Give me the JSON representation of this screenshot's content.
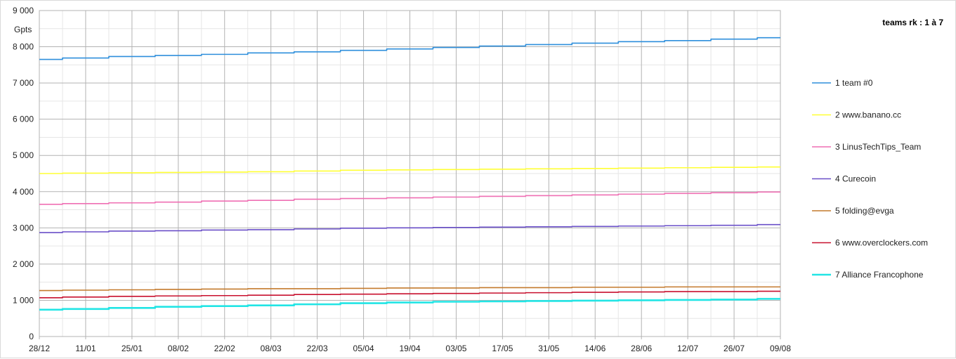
{
  "chart_data": {
    "type": "line",
    "ylabel": "Gpts",
    "ylim": [
      0,
      9000
    ],
    "ytick_labels": [
      "0",
      "1 000",
      "2 000",
      "3 000",
      "4 000",
      "5 000",
      "6 000",
      "7 000",
      "8 000",
      "9 000"
    ],
    "y_minor_step": 500,
    "x": [
      "28/12",
      "11/01",
      "25/01",
      "08/02",
      "22/02",
      "08/03",
      "22/03",
      "05/04",
      "19/04",
      "03/05",
      "17/05",
      "31/05",
      "14/06",
      "28/06",
      "12/07",
      "26/07",
      "09/08"
    ],
    "grid": true,
    "legend_title": "teams rk : 1 à 7",
    "legend_position": "right",
    "series": [
      {
        "name": "1 team #0",
        "color": "#2e8fdc",
        "values": [
          7650,
          7690,
          7730,
          7760,
          7790,
          7830,
          7860,
          7900,
          7940,
          7980,
          8020,
          8060,
          8100,
          8140,
          8170,
          8210,
          8250
        ]
      },
      {
        "name": "2 www.banano.cc",
        "color": "#ffff33",
        "values": [
          4500,
          4510,
          4520,
          4530,
          4540,
          4550,
          4570,
          4590,
          4600,
          4610,
          4620,
          4630,
          4640,
          4650,
          4660,
          4670,
          4680
        ]
      },
      {
        "name": "3 LinusTechTips_Team",
        "color": "#ef6fb3",
        "values": [
          3650,
          3670,
          3690,
          3710,
          3740,
          3760,
          3790,
          3810,
          3830,
          3850,
          3870,
          3890,
          3910,
          3930,
          3950,
          3970,
          3990
        ]
      },
      {
        "name": "4 Curecoin",
        "color": "#6a4fc8",
        "values": [
          2870,
          2890,
          2910,
          2920,
          2940,
          2950,
          2970,
          2990,
          3000,
          3010,
          3020,
          3030,
          3040,
          3050,
          3060,
          3070,
          3090
        ]
      },
      {
        "name": "5 folding@evga",
        "color": "#c47a2c",
        "values": [
          1270,
          1280,
          1290,
          1300,
          1310,
          1320,
          1320,
          1330,
          1340,
          1340,
          1350,
          1350,
          1360,
          1360,
          1370,
          1370,
          1370
        ]
      },
      {
        "name": "6 www.overclockers.com",
        "color": "#c8102e",
        "values": [
          1070,
          1090,
          1110,
          1120,
          1130,
          1140,
          1160,
          1170,
          1180,
          1190,
          1200,
          1210,
          1220,
          1230,
          1240,
          1240,
          1250
        ]
      },
      {
        "name": "7 Alliance Francophone",
        "color": "#22e5e5",
        "values": [
          740,
          760,
          790,
          820,
          840,
          860,
          890,
          920,
          940,
          960,
          970,
          980,
          990,
          1000,
          1010,
          1020,
          1040
        ]
      }
    ]
  }
}
